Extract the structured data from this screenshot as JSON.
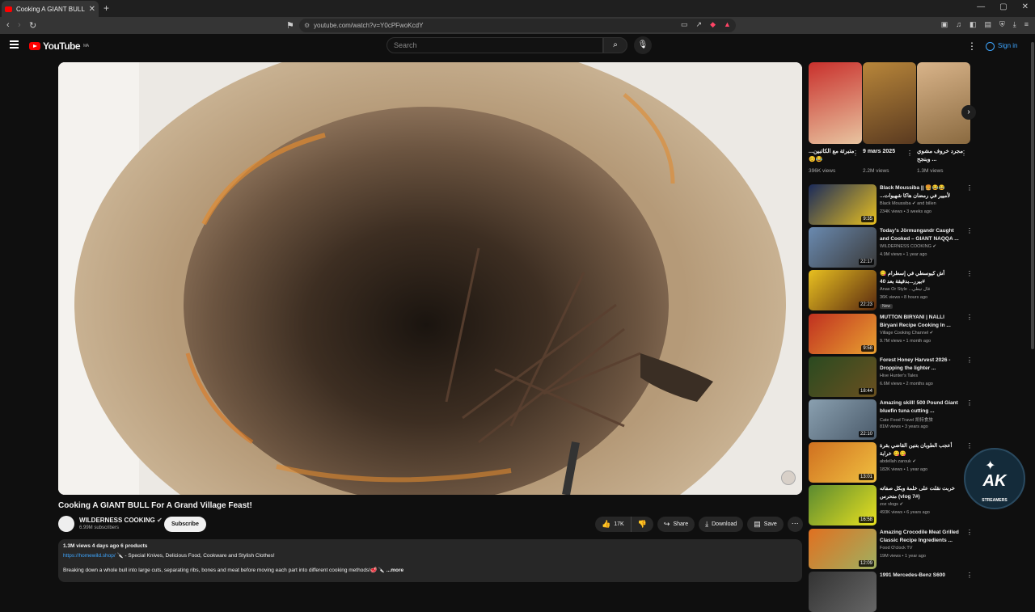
{
  "browser": {
    "tab_title": "Cooking A GIANT BULL For A Gr",
    "tab_close": "✕",
    "new_tab": "+",
    "url": "youtube.com/watch?v=Y0cPFwoKcdY"
  },
  "header": {
    "logo_text": "YouTube",
    "logo_region": "MA",
    "search_placeholder": "Search",
    "signin_label": "Sign in"
  },
  "video": {
    "title": "Cooking A GIANT BULL For A Grand Village Feast!",
    "channel": "WILDERNESS COOKING",
    "subscribers": "6.99M subscribers",
    "subscribe_label": "Subscribe",
    "likes": "17K",
    "share_label": "Share",
    "download_label": "Download",
    "save_label": "Save"
  },
  "description": {
    "meta": "1.3M views  4 days ago  6 products",
    "link": "https://homewild.shop/",
    "line1_rest": "  🔪 - Special Knives, Delicious Food, Cookware and Stylish Clothes!",
    "line2": "Breaking down a whole bull into large cuts, separating ribs, bones and meat before moving each part into different cooking methods!🥩 🔪",
    "more": "...more"
  },
  "shorts": [
    {
      "title": "...متبرئة مع الكاتبين 😊😂",
      "views": "396K views",
      "colors": [
        "#c9302c",
        "#e8c4a0"
      ]
    },
    {
      "title": "9 mars 2025",
      "views": "2.2M views",
      "colors": [
        "#b8863a",
        "#5a3a20"
      ]
    },
    {
      "title": "مجرد خروف مشوي وبنجح ...",
      "views": "1.3M views",
      "colors": [
        "#d9b48a",
        "#8a6a40"
      ]
    }
  ],
  "recommendations": [
    {
      "title": "Black Moussiba || 🍔😂😂 ...لأميير في رمضان هاكا شهيوات",
      "channel": "Black Moussiba ✔ and billen",
      "views": "234K views • 3 weeks ago",
      "duration": "9:35",
      "colors": [
        "#1a2a5a",
        "#e8c020"
      ]
    },
    {
      "title": "Today's Jörmungandr Caught and Cooked – GIANT NAQQA ...",
      "channel": "WILDERNESS COOKING ✔",
      "views": "4.9M views • 1 year ago",
      "duration": "22:17",
      "colors": [
        "#6a8ab0",
        "#3a3a3a"
      ]
    },
    {
      "title": "أش كيوسطي في إسطرام 😋 بيرر...بدقيقة بعد 40#",
      "channel": "Anas Or Style ...قال تيطي",
      "views": "36K views • 8 hours ago",
      "duration": "22:23",
      "badge": "New",
      "colors": [
        "#e8c020",
        "#5a2a10"
      ]
    },
    {
      "title": "MUTTON BIRYANI | NALLI Biryani Recipe Cooking In ...",
      "channel": "Village Cooking Channel ✔",
      "views": "9.7M views • 1 month ago",
      "duration": "9:58",
      "colors": [
        "#c03020",
        "#e8a030"
      ]
    },
    {
      "title": "Forest Honey Harvest 2026 - Dropping the lighter ...",
      "channel": "Hive Hunter's Tales",
      "views": "6.6M views • 2 months ago",
      "duration": "18:44",
      "colors": [
        "#2a4a20",
        "#6a5020"
      ]
    },
    {
      "title": "Amazing skill! 500 Pound Giant bluefin tuna cutting ...",
      "channel": "Cate Food Travel 凯特食旅",
      "views": "81M views • 3 years ago",
      "duration": "22:10",
      "colors": [
        "#8aa0b0",
        "#4a5a6a"
      ]
    },
    {
      "title": "أعجب الطوبان بتنين القاضي بقرة خرابة 😋😋",
      "channel": "abdellah zarouk ✔",
      "views": "182K views • 1 year ago",
      "duration": "13:01",
      "colors": [
        "#d07020",
        "#f0c040"
      ]
    },
    {
      "title": "خربت نقلت على خلمة وبكل صفاته متحرس (vlog 7#)",
      "channel": "zoz vlogs ✔",
      "views": "493K views • 6 years ago",
      "duration": "16:58",
      "colors": [
        "#5a8a30",
        "#e8e020"
      ]
    },
    {
      "title": "Amazing Crocodile Meat Grilled Classic Recipe Ingredients ...",
      "channel": "Food O'clock TV",
      "views": "19M views • 1 year ago",
      "duration": "12:09",
      "colors": [
        "#e07020",
        "#a0b060"
      ]
    },
    {
      "title": "1991 Mercedes-Benz S600",
      "channel": "",
      "views": "",
      "duration": "",
      "colors": [
        "#333333",
        "#666666"
      ]
    }
  ],
  "overlay_logo": {
    "text": "AK",
    "sub": "STREAMERS"
  }
}
